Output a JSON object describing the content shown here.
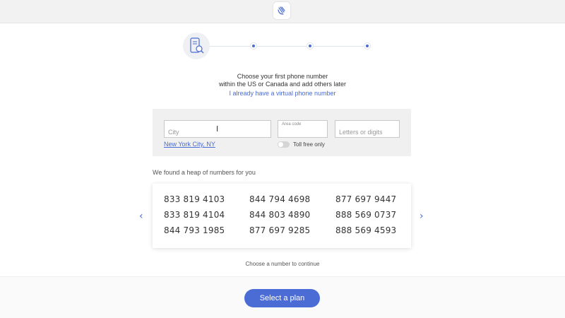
{
  "header": {
    "logo_icon": "waving-hand-icon"
  },
  "stepper": {
    "step_icon": "phone-search-icon",
    "steps": 4,
    "current": 1
  },
  "intro": {
    "line1": "Choose your first phone number",
    "line2": "within the US or Canada and add others later",
    "link": "I already have a virtual phone number"
  },
  "search": {
    "city_placeholder": "City",
    "area_code_label": "Area code",
    "area_code_value": "",
    "letters_placeholder": "Letters or digits",
    "city_link": "New York City, NY",
    "toll_free_label": "Toll free only"
  },
  "results": {
    "heading": "We found a heap of numbers for you",
    "numbers": [
      "833 819 4103",
      "844 794 4698",
      "877 697 9447",
      "833 819 4104",
      "844 803 4890",
      "888 569 0737",
      "844 793 1985",
      "877 697 9285",
      "888 569 4593"
    ],
    "prev_icon": "chevron-left-icon",
    "next_icon": "chevron-right-icon",
    "footer_hint": "Choose a number to continue"
  },
  "footer": {
    "button_label": "Select a plan"
  },
  "colors": {
    "accent": "#4a6cd4",
    "panel": "#f0f0f0"
  }
}
